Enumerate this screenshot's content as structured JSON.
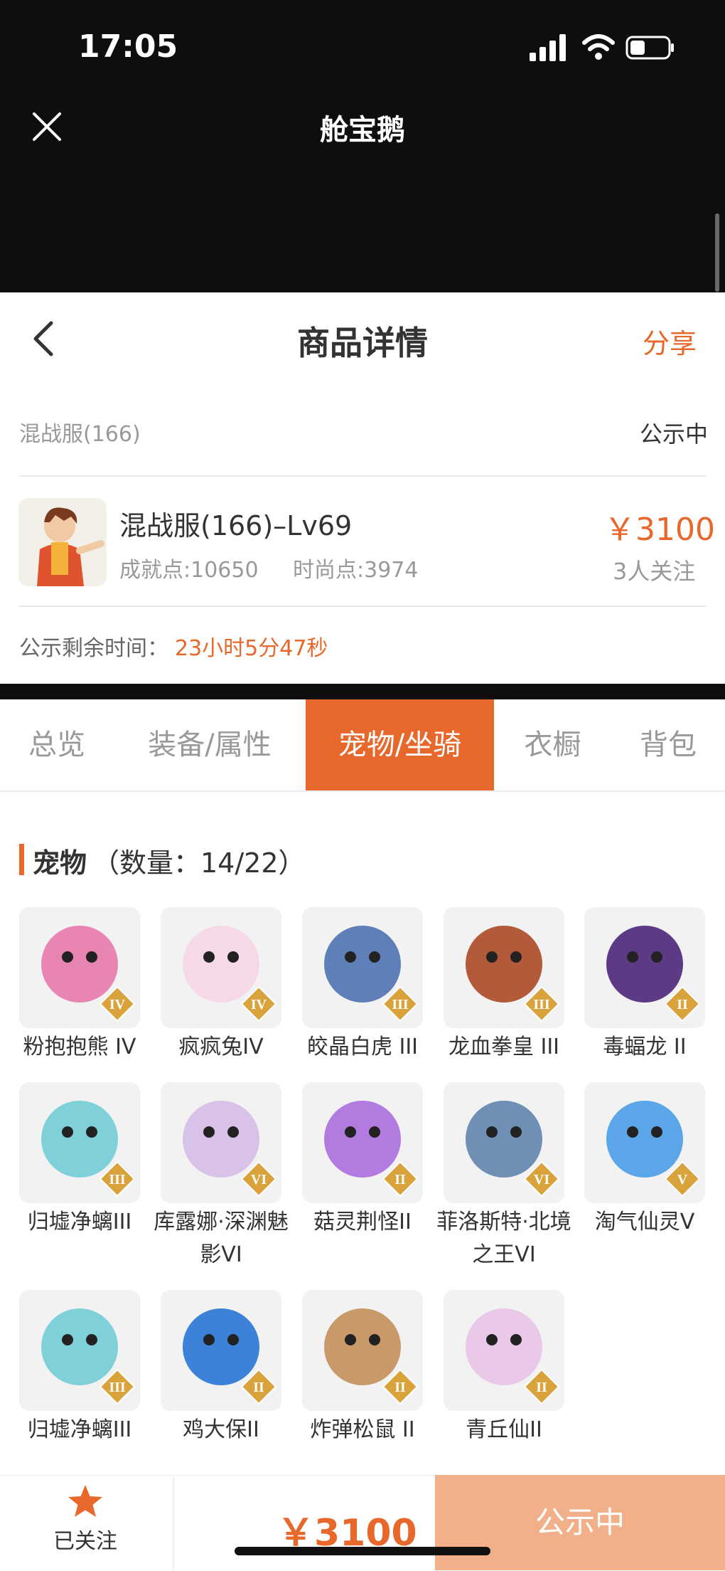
{
  "status_bar": {
    "time": "17:05"
  },
  "app": {
    "title": "舱宝鹅"
  },
  "header": {
    "title": "商品详情",
    "share": "分享"
  },
  "product": {
    "server": "混战服(166)",
    "status": "公示中",
    "name": "混战服(166)–Lv69",
    "achievement": "成就点:10650",
    "fashion": "时尚点:3974",
    "price": "￥3100",
    "followers": "3人关注",
    "remain_label": "公示剩余时间：",
    "remain_value": "23小时5分47秒"
  },
  "tabs": [
    "总览",
    "装备/属性",
    "宠物/坐骑",
    "衣橱",
    "背包"
  ],
  "active_tab": "宠物/坐骑",
  "pets_section": {
    "title": "宠物",
    "count": "（数量：14/22）"
  },
  "pets": [
    {
      "name": "粉抱抱熊 IV",
      "rank": "IV",
      "color": "#e985b3"
    },
    {
      "name": "疯疯兔IV",
      "rank": "IV",
      "color": "#f6d9e6"
    },
    {
      "name": "皎晶白虎 III",
      "rank": "III",
      "color": "#5f7fb8"
    },
    {
      "name": "龙血拳皇 III",
      "rank": "III",
      "color": "#b35a3a"
    },
    {
      "name": "毒蝠龙 II",
      "rank": "II",
      "color": "#5d3a86"
    },
    {
      "name": "归墟净螭III",
      "rank": "III",
      "color": "#7fd0d8"
    },
    {
      "name": "库露娜·深渊魅影VI",
      "rank": "VI",
      "color": "#d8c2e8"
    },
    {
      "name": "菇灵荆怪II",
      "rank": "II",
      "color": "#b27be0"
    },
    {
      "name": "菲洛斯特·北境之王VI",
      "rank": "VI",
      "color": "#6f8fb5"
    },
    {
      "name": "淘气仙灵V",
      "rank": "V",
      "color": "#5aa6e8"
    },
    {
      "name": "归墟净螭III",
      "rank": "III",
      "color": "#7fd0d8"
    },
    {
      "name": "鸡大保II",
      "rank": "II",
      "color": "#3b82d8"
    },
    {
      "name": "炸弹松鼠 II",
      "rank": "II",
      "color": "#c89a6a"
    },
    {
      "name": "青丘仙II",
      "rank": "II",
      "color": "#e9c8e8"
    }
  ],
  "bottom": {
    "follow_label": "已关注",
    "price": "￥3100",
    "button": "公示中"
  },
  "colors": {
    "accent": "#e8672a",
    "button_disabled": "#f2b08a"
  }
}
